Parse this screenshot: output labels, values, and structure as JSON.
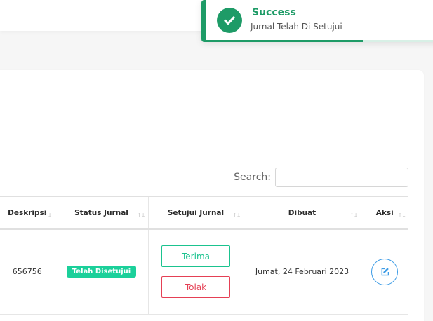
{
  "search": {
    "label": "Search:",
    "placeholder": "",
    "value": ""
  },
  "table": {
    "headers": [
      "Deskripsi",
      "Status Jurnal",
      "Setujui Jurnal",
      "Dibuat",
      "Aksi"
    ],
    "sort_icon": "↑↓",
    "rows": [
      {
        "deskripsi": "656756",
        "status": "Telah Disetujui",
        "accept_label": "Terima",
        "reject_label": "Tolak",
        "dibuat": "Jumat, 24 Februari 2023",
        "action_icon": "edit-icon"
      }
    ]
  },
  "toast": {
    "title": "Success",
    "message": "Jurnal Telah Di Setujui",
    "icon": "check-circle-icon",
    "progress": 0.67
  },
  "colors": {
    "success": "#1e9b67",
    "badge": "#1bd09a",
    "accept": "#1bc38f",
    "reject": "#e54055",
    "edit": "#3d9ce6"
  }
}
